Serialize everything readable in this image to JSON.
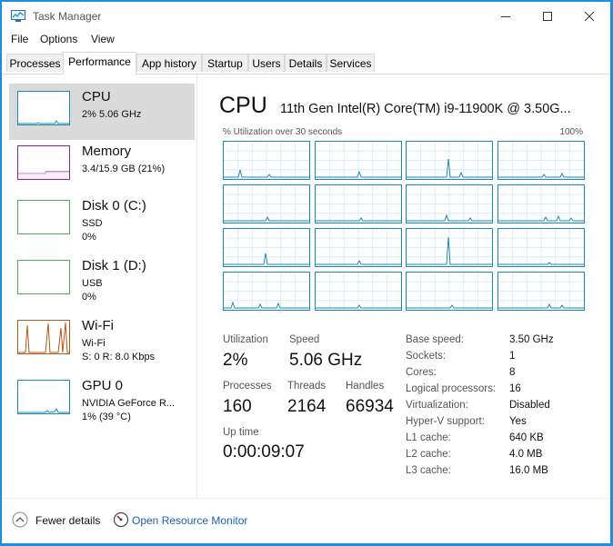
{
  "window": {
    "title": "Task Manager"
  },
  "menu": [
    "File",
    "Options",
    "View"
  ],
  "tabs": [
    {
      "label": "Processes",
      "active": false
    },
    {
      "label": "Performance",
      "active": true
    },
    {
      "label": "App history",
      "active": false
    },
    {
      "label": "Startup",
      "active": false
    },
    {
      "label": "Users",
      "active": false
    },
    {
      "label": "Details",
      "active": false
    },
    {
      "label": "Services",
      "active": false
    }
  ],
  "sidebar": {
    "items": [
      {
        "name": "CPU",
        "lines": [
          "2% 5.06 GHz"
        ],
        "color": "#1a8ab5",
        "selected": true
      },
      {
        "name": "Memory",
        "lines": [
          "3.4/15.9 GB (21%)"
        ],
        "color": "#8b1e9b",
        "selected": false
      },
      {
        "name": "Disk 0 (C:)",
        "lines": [
          "SSD",
          "0%"
        ],
        "color": "#4caf50",
        "selected": false
      },
      {
        "name": "Disk 1 (D:)",
        "lines": [
          "USB",
          "0%"
        ],
        "color": "#4caf50",
        "selected": false
      },
      {
        "name": "Wi-Fi",
        "lines": [
          "Wi-Fi",
          "S: 0 R: 8.0 Kbps"
        ],
        "color": "#b4581a",
        "selected": false
      },
      {
        "name": "GPU 0",
        "lines": [
          "NVIDIA GeForce R...",
          "1% (39 °C)"
        ],
        "color": "#1a8ab5",
        "selected": false
      }
    ]
  },
  "cpu": {
    "title": "CPU",
    "processor": "11th Gen Intel(R) Core(TM) i9-11900K @ 3.50G...",
    "graph_label": "% Utilization over 30 seconds",
    "graph_max": "100%",
    "graph_color": "#1a8ab5",
    "stats": {
      "utilization_label": "Utilization",
      "utilization": "2%",
      "speed_label": "Speed",
      "speed": "5.06 GHz",
      "processes_label": "Processes",
      "processes": "160",
      "threads_label": "Threads",
      "threads": "2164",
      "handles_label": "Handles",
      "handles": "66934",
      "uptime_label": "Up time",
      "uptime": "0:00:09:07"
    },
    "details": [
      {
        "label": "Base speed:",
        "value": "3.50 GHz"
      },
      {
        "label": "Sockets:",
        "value": "1"
      },
      {
        "label": "Cores:",
        "value": "8"
      },
      {
        "label": "Logical processors:",
        "value": "16"
      },
      {
        "label": "Virtualization:",
        "value": "Disabled"
      },
      {
        "label": "Hyper-V support:",
        "value": "Yes"
      },
      {
        "label": "L1 cache:",
        "value": "640 KB"
      },
      {
        "label": "L2 cache:",
        "value": "4.0 MB"
      },
      {
        "label": "L3 cache:",
        "value": "16.0 MB"
      }
    ]
  },
  "footer": {
    "fewer_details": "Fewer details",
    "open_resource_monitor": "Open Resource Monitor"
  },
  "icons": {
    "app": "task-manager-icon",
    "minimize": "minimize-icon",
    "maximize": "maximize-icon",
    "close": "close-icon",
    "fewer": "chevron-up-circle-icon",
    "resource_monitor": "resource-monitor-icon"
  }
}
